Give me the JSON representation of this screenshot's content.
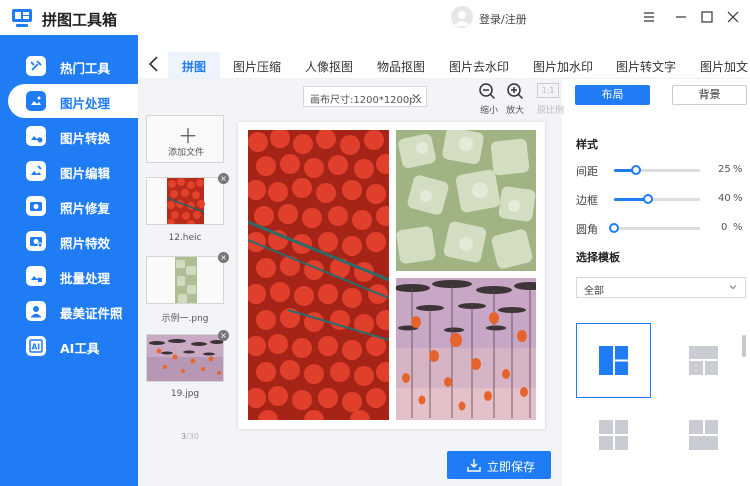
{
  "app": {
    "title": "拼图工具箱",
    "login_label": "登录/注册"
  },
  "colors": {
    "brand": "#1f7cf4",
    "sidebar_bg": "#1f7cf4",
    "canvas_bg": "#f3f4f7"
  },
  "sidebar": {
    "items": [
      {
        "label": "热门工具",
        "icon": "tools-icon",
        "active": false
      },
      {
        "label": "图片处理",
        "icon": "image-process-icon",
        "active": true
      },
      {
        "label": "图片转换",
        "icon": "image-convert-icon",
        "active": false
      },
      {
        "label": "图片编辑",
        "icon": "image-edit-icon",
        "active": false
      },
      {
        "label": "照片修复",
        "icon": "photo-repair-icon",
        "active": false
      },
      {
        "label": "照片特效",
        "icon": "photo-effect-icon",
        "active": false
      },
      {
        "label": "批量处理",
        "icon": "batch-icon",
        "active": false
      },
      {
        "label": "最美证件照",
        "icon": "id-photo-icon",
        "active": false
      },
      {
        "label": "AI工具",
        "icon": "ai-icon",
        "active": false
      }
    ]
  },
  "tabs": [
    {
      "label": "拼图",
      "active": true
    },
    {
      "label": "图片压缩"
    },
    {
      "label": "人像抠图"
    },
    {
      "label": "物品抠图"
    },
    {
      "label": "图片去水印"
    },
    {
      "label": "图片加水印"
    },
    {
      "label": "图片转文字"
    },
    {
      "label": "图片加文"
    }
  ],
  "toolbar": {
    "canvas_size": "画布尺寸:1200*1200px",
    "zoom_out_label": "缩小",
    "zoom_in_label": "放大",
    "ratio_box": "1:1",
    "ratio_label": "原比例"
  },
  "files": {
    "add_label": "添加文件",
    "items": [
      {
        "name": "12.heic"
      },
      {
        "name": "示例一.png"
      },
      {
        "name": "19.jpg"
      }
    ],
    "page_current": "3",
    "page_total": "/30"
  },
  "save_label": "立即保存",
  "panel": {
    "layout_label": "布局",
    "background_label": "背景",
    "style_title": "样式",
    "sliders": [
      {
        "label": "间距",
        "value": 25,
        "unit": "%"
      },
      {
        "label": "边框",
        "value": 40,
        "unit": "%"
      },
      {
        "label": "圆角",
        "value": 0,
        "unit": "%"
      }
    ],
    "template_title": "选择模板",
    "template_filter": "全部"
  }
}
